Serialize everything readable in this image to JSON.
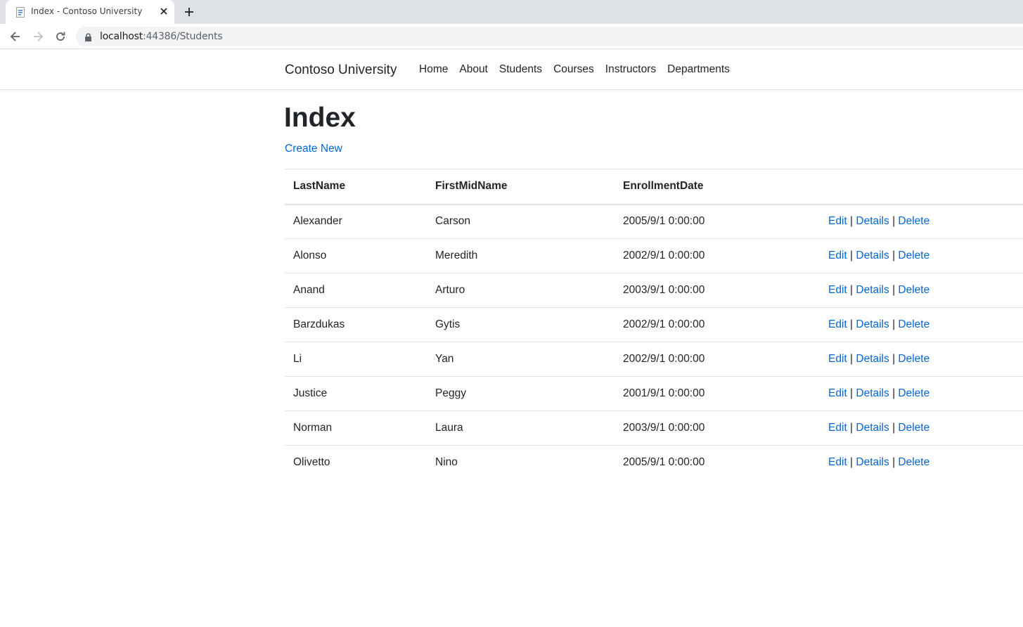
{
  "browser": {
    "tab_title": "Index - Contoso University",
    "url_host": "localhost",
    "url_rest": ":44386/Students"
  },
  "navbar": {
    "brand": "Contoso University",
    "links": [
      "Home",
      "About",
      "Students",
      "Courses",
      "Instructors",
      "Departments"
    ]
  },
  "page": {
    "title": "Index",
    "create_link": "Create New"
  },
  "table": {
    "headers": [
      "LastName",
      "FirstMidName",
      "EnrollmentDate"
    ],
    "actions": {
      "edit": "Edit",
      "details": "Details",
      "delete": "Delete",
      "separator": "|"
    },
    "rows": [
      {
        "last": "Alexander",
        "first": "Carson",
        "date": "2005/9/1 0:00:00"
      },
      {
        "last": "Alonso",
        "first": "Meredith",
        "date": "2002/9/1 0:00:00"
      },
      {
        "last": "Anand",
        "first": "Arturo",
        "date": "2003/9/1 0:00:00"
      },
      {
        "last": "Barzdukas",
        "first": "Gytis",
        "date": "2002/9/1 0:00:00"
      },
      {
        "last": "Li",
        "first": "Yan",
        "date": "2002/9/1 0:00:00"
      },
      {
        "last": "Justice",
        "first": "Peggy",
        "date": "2001/9/1 0:00:00"
      },
      {
        "last": "Norman",
        "first": "Laura",
        "date": "2003/9/1 0:00:00"
      },
      {
        "last": "Olivetto",
        "first": "Nino",
        "date": "2005/9/1 0:00:00"
      }
    ]
  },
  "colors": {
    "link": "#0366d6",
    "text": "#212529",
    "border": "#dee2e6",
    "tabstrip": "#dee1e6"
  }
}
